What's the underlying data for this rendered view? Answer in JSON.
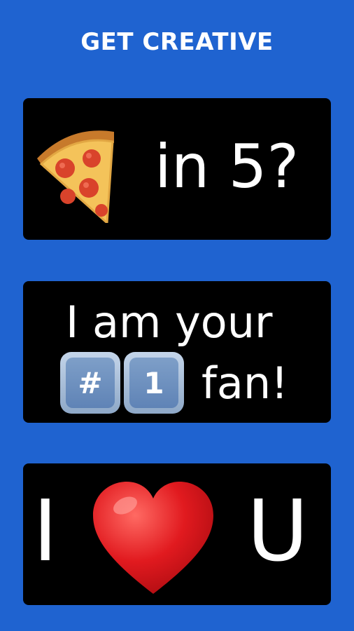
{
  "page": {
    "title": "GET CREATIVE",
    "background_color": "#1f63d0"
  },
  "cards": [
    {
      "icon": "pizza-slice-icon",
      "text": "in 5?"
    },
    {
      "line1": "I am your",
      "keycaps": [
        {
          "icon": "keycap-hash-icon",
          "label": "#"
        },
        {
          "icon": "keycap-one-icon",
          "label": "1"
        }
      ],
      "line2_suffix": "fan!"
    },
    {
      "left_text": "I",
      "icon": "red-heart-icon",
      "right_text": "U"
    }
  ],
  "colors": {
    "card_background": "#000000",
    "text": "#ffffff",
    "heart": "#e11a1f",
    "keycap": "#6f91c0"
  }
}
